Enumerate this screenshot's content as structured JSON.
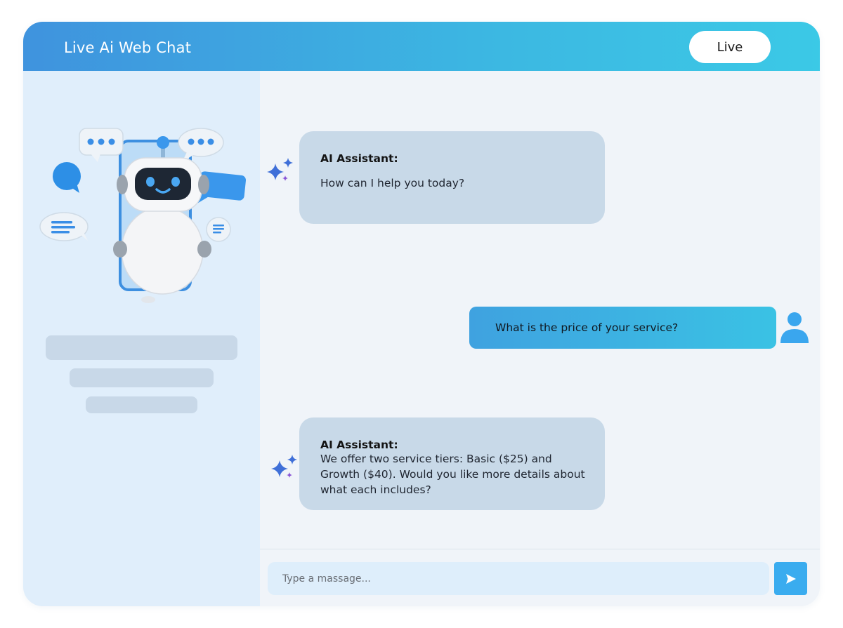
{
  "header": {
    "title": "Live Ai Web Chat",
    "status_button": "Live"
  },
  "sidebar": {
    "illustration": "robot-chatbot-illustration"
  },
  "messages": [
    {
      "role": "assistant",
      "sender": "AI Assistant:",
      "text": "How can I help you today?"
    },
    {
      "role": "user",
      "text": "What is the price of your service?"
    },
    {
      "role": "assistant",
      "sender": "AI Assistant:",
      "text": "We offer two service tiers: Basic ($25) and Growth ($40). Would you like more details about what each includes?"
    }
  ],
  "composer": {
    "placeholder": "Type a massage...",
    "send_icon": "send-icon"
  },
  "colors": {
    "header_gradient_start": "#3f93de",
    "header_gradient_end": "#3bc9e6",
    "sidebar_bg": "#e0eefb",
    "assistant_bubble": "#c8d9e8",
    "user_bubble_start": "#3fa2e0",
    "user_bubble_end": "#3ac2e4",
    "send_button": "#3aacef"
  }
}
